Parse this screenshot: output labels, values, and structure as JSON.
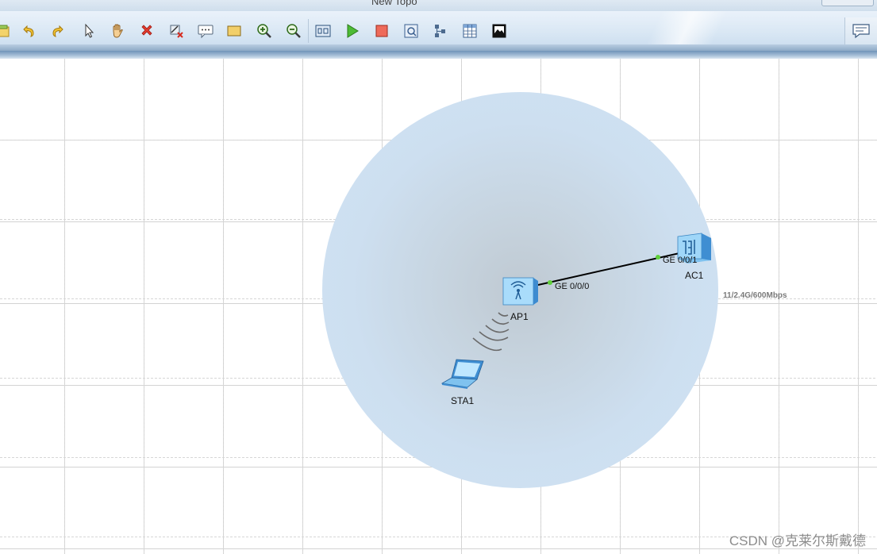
{
  "window": {
    "title": "New Topo"
  },
  "toolbar": {
    "buttons": [
      {
        "name": "open-icon"
      },
      {
        "name": "undo-icon"
      },
      {
        "name": "redo-icon"
      },
      {
        "name": "select-pointer-icon"
      },
      {
        "name": "pan-hand-icon"
      },
      {
        "name": "delete-icon"
      },
      {
        "name": "delete-link-icon"
      },
      {
        "name": "text-comment-icon"
      },
      {
        "name": "rectangle-icon"
      },
      {
        "name": "zoom-in-icon"
      },
      {
        "name": "zoom-out-icon"
      },
      {
        "name": "fit-view-icon"
      },
      {
        "name": "start-device-icon"
      },
      {
        "name": "stop-device-icon"
      },
      {
        "name": "capture-icon"
      },
      {
        "name": "topology-icon"
      },
      {
        "name": "grid-table-icon"
      },
      {
        "name": "screenshot-icon"
      }
    ],
    "chat_icon": "chat-icon"
  },
  "topology": {
    "devices": [
      {
        "id": "ap1",
        "label": "AP1",
        "type": "access-point"
      },
      {
        "id": "ac1",
        "label": "AC1",
        "type": "access-controller"
      },
      {
        "id": "sta1",
        "label": "STA1",
        "type": "wireless-station"
      }
    ],
    "links": [
      {
        "from": "ap1",
        "from_port": "GE 0/0/0",
        "to": "ac1",
        "to_port": "GE 0/0/1"
      }
    ],
    "wireless": {
      "rate_label": "11/2.4G/600Mbps"
    },
    "colors": {
      "coverage": "#cfe3f5",
      "port_up": "#5fd03a",
      "link": "#000000"
    }
  },
  "watermark": "CSDN @克莱尔斯戴德"
}
